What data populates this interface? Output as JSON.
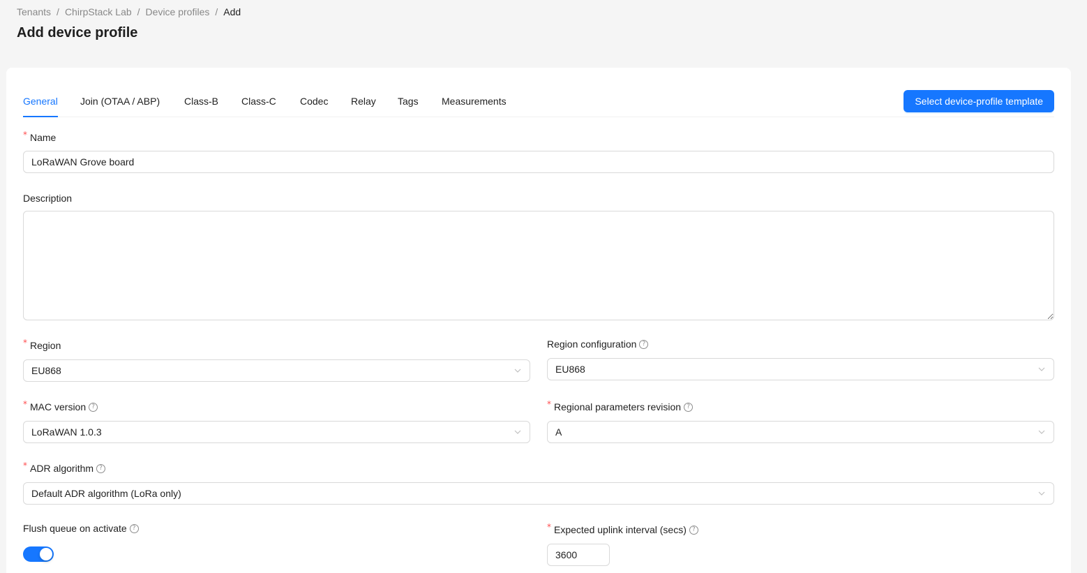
{
  "breadcrumb": {
    "items": [
      "Tenants",
      "ChirpStack Lab",
      "Device profiles",
      "Add"
    ],
    "separator": "/"
  },
  "page_title": "Add device profile",
  "tabs": [
    {
      "label": "General",
      "active": true
    },
    {
      "label": "Join (OTAA / ABP)",
      "active": false
    },
    {
      "label": "Class-B",
      "active": false
    },
    {
      "label": "Class-C",
      "active": false
    },
    {
      "label": "Codec",
      "active": false
    },
    {
      "label": "Relay",
      "active": false
    },
    {
      "label": "Tags",
      "active": false
    },
    {
      "label": "Measurements",
      "active": false
    }
  ],
  "template_button": "Select device-profile template",
  "form": {
    "name": {
      "label": "Name",
      "required": true,
      "value": "LoRaWAN Grove board"
    },
    "description": {
      "label": "Description",
      "value": ""
    },
    "region": {
      "label": "Region",
      "required": true,
      "value": "EU868"
    },
    "region_configuration": {
      "label": "Region configuration",
      "value": "EU868"
    },
    "mac_version": {
      "label": "MAC version",
      "required": true,
      "value": "LoRaWAN 1.0.3"
    },
    "regional_parameters_revision": {
      "label": "Regional parameters revision",
      "required": true,
      "value": "A"
    },
    "adr_algorithm": {
      "label": "ADR algorithm",
      "required": true,
      "value": "Default ADR algorithm (LoRa only)"
    },
    "flush_queue": {
      "label": "Flush queue on activate",
      "enabled": true
    },
    "uplink_interval": {
      "label": "Expected uplink interval (secs)",
      "required": true,
      "value": "3600"
    }
  },
  "colors": {
    "primary": "#1677ff",
    "required": "#ff4d4f",
    "background": "#f5f5f5"
  },
  "icons": {
    "help": "question-circle-icon",
    "dropdown": "chevron-down-icon"
  }
}
